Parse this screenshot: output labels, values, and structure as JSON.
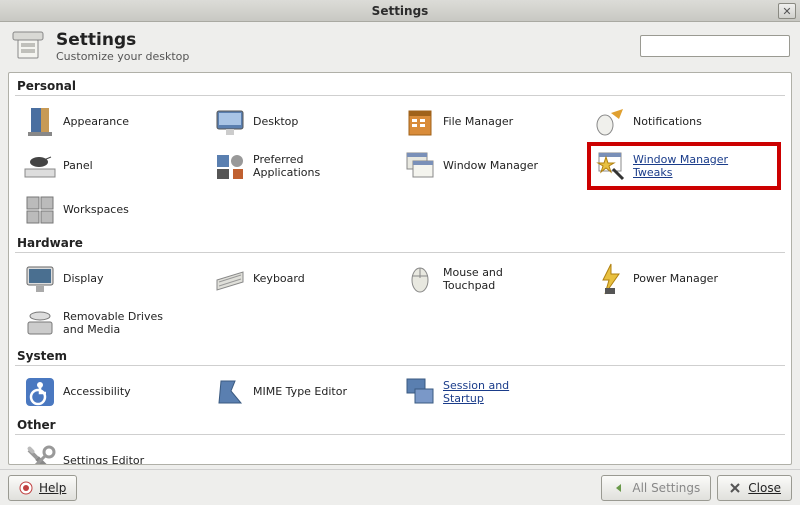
{
  "window": {
    "title": "Settings"
  },
  "header": {
    "title": "Settings",
    "subtitle": "Customize your desktop",
    "search_value": ""
  },
  "sections": {
    "personal": {
      "label": "Personal",
      "items": {
        "appearance": "Appearance",
        "desktop": "Desktop",
        "file_manager": "File Manager",
        "notifications": "Notifications",
        "panel": "Panel",
        "preferred_apps": "Preferred\nApplications",
        "window_manager": "Window Manager",
        "wm_tweaks": "Window Manager\nTweaks",
        "workspaces": "Workspaces"
      }
    },
    "hardware": {
      "label": "Hardware",
      "items": {
        "display": "Display",
        "keyboard": "Keyboard",
        "mouse": "Mouse and\nTouchpad",
        "power": "Power Manager",
        "removable": "Removable Drives\nand Media"
      }
    },
    "system": {
      "label": "System",
      "items": {
        "accessibility": "Accessibility",
        "mime": "MIME Type Editor",
        "session": "Session and\nStartup"
      }
    },
    "other": {
      "label": "Other",
      "items": {
        "settings_editor": "Settings Editor"
      }
    }
  },
  "footer": {
    "help": "Help",
    "all_settings": "All Settings",
    "close": "Close"
  }
}
